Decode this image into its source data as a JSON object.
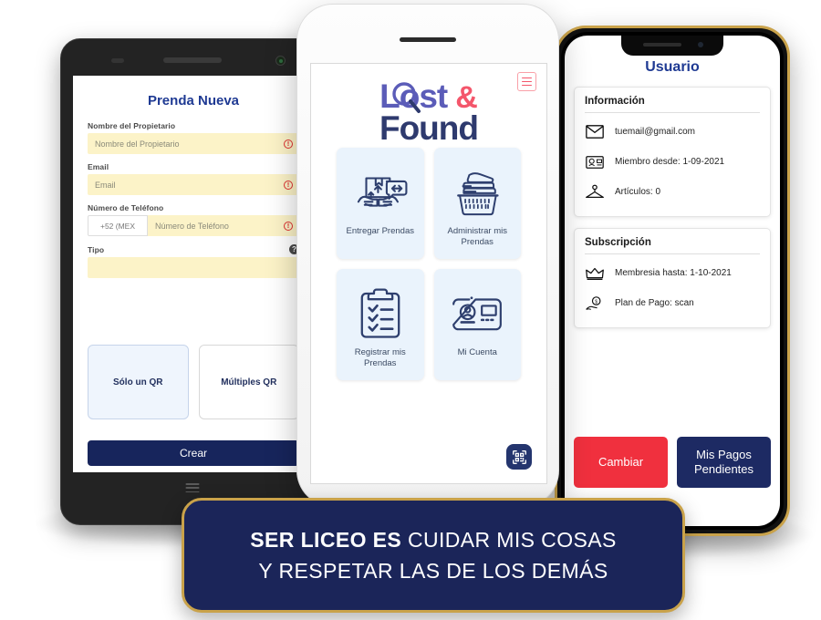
{
  "left_phone": {
    "name": "prenda-nueva-form",
    "title": "Prenda Nueva",
    "fields": [
      {
        "label": "Nombre del Propietario",
        "placeholder": "Nombre del Propietario",
        "value": "",
        "error": true
      },
      {
        "label": "Email",
        "placeholder": "Email",
        "value": "",
        "error": true
      },
      {
        "label": "Número de Teléfono",
        "placeholder": "Número de Teléfono",
        "value": "",
        "error": true,
        "country_code": "+52 (MEX"
      },
      {
        "label": "Tipo",
        "placeholder": "",
        "value": "",
        "error": false,
        "help": "?"
      }
    ],
    "qr_options": [
      {
        "label": "Sólo un QR",
        "selected": true
      },
      {
        "label": "Múltiples QR",
        "selected": false
      }
    ],
    "submit_label": "Crear",
    "nav_icon": "hamburger-icon"
  },
  "center_phone": {
    "logo": {
      "word1": "Lost",
      "amp": "&",
      "word2": "Found"
    },
    "menu_icon": "hamburger-icon",
    "cards": [
      {
        "label": "Entregar Prendas",
        "icon": "handoff-package-icon"
      },
      {
        "label": "Administrar mis Prendas",
        "icon": "laundry-basket-icon"
      },
      {
        "label": "Registrar mis Prendas",
        "icon": "clipboard-checklist-icon"
      },
      {
        "label": "Mi Cuenta",
        "icon": "id-card-icon"
      }
    ],
    "fab": {
      "icon": "qr-scan-icon"
    }
  },
  "right_phone": {
    "title": "Usuario",
    "sections": [
      {
        "heading": "Información",
        "rows": [
          {
            "icon": "envelope-icon",
            "text": "tuemail@gmail.com"
          },
          {
            "icon": "id-badge-icon",
            "text": "Miembro desde: 1-09-2021"
          },
          {
            "icon": "hanger-icon",
            "text": "Artículos: 0"
          }
        ]
      },
      {
        "heading": "Subscripción",
        "rows": [
          {
            "icon": "crown-icon",
            "text": "Membresia hasta: 1-10-2021"
          },
          {
            "icon": "money-hand-icon",
            "text": "Plan de Pago: scan"
          }
        ]
      }
    ],
    "buttons": [
      {
        "label": "Cambiar",
        "style": "red"
      },
      {
        "label": "Mis Pagos Pendientes",
        "style": "navy"
      }
    ]
  },
  "banner": {
    "line1_bold": "SER LICEO ES",
    "line1_rest": "CUIDAR MIS COSAS",
    "line2": "Y RESPETAR LAS DE LOS DEMÁS"
  },
  "colors": {
    "navy": "#1b2559",
    "gold": "#c9a24a",
    "brand_purple": "#5b5cb8",
    "brand_coral": "#f4566b",
    "brand_dark": "#2e3a6e",
    "input_yellow": "#FCF3C8",
    "error_red": "#e03030",
    "card_blue": "#eaf3fc",
    "title_blue": "#1f3a93",
    "danger_red": "#f0303e"
  }
}
